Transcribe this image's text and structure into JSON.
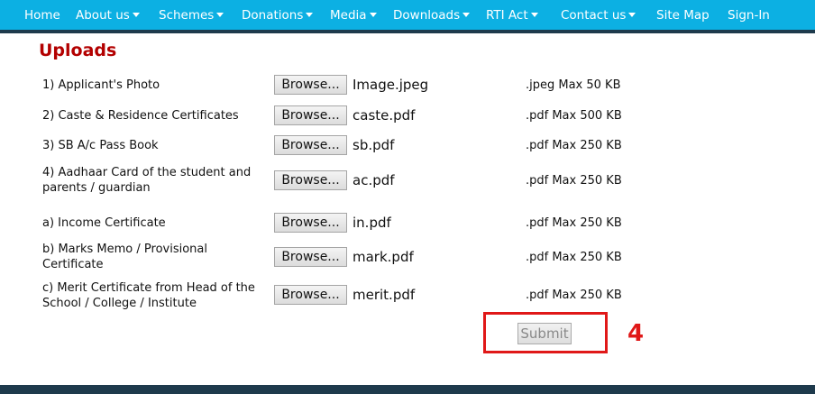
{
  "nav": {
    "items": [
      {
        "label": "Home",
        "dropdown": false
      },
      {
        "label": "About us",
        "dropdown": true
      },
      {
        "label": "Schemes",
        "dropdown": true
      },
      {
        "label": "Donations",
        "dropdown": true
      },
      {
        "label": "Media",
        "dropdown": true
      },
      {
        "label": "Downloads",
        "dropdown": true
      },
      {
        "label": "RTI Act",
        "dropdown": true
      },
      {
        "label": "Contact us",
        "dropdown": true
      },
      {
        "label": "Site Map",
        "dropdown": false
      },
      {
        "label": "Sign-In",
        "dropdown": false
      }
    ]
  },
  "page": {
    "title": "Uploads"
  },
  "uploads": {
    "browse_label": "Browse...",
    "rows": [
      {
        "label": "1) Applicant's Photo",
        "file": "Image.jpeg",
        "limit": ".jpeg Max 50 KB"
      },
      {
        "label": "2) Caste  & Residence Certificates",
        "file": "caste.pdf",
        "limit": ".pdf Max 500 KB"
      },
      {
        "label": "3) SB A/c Pass Book",
        "file": "sb.pdf",
        "limit": ".pdf Max 250 KB"
      },
      {
        "label": "4) Aadhaar Card of the student and parents / guardian",
        "file": "ac.pdf",
        "limit": ".pdf Max 250 KB"
      },
      {
        "label": "a) Income Certificate",
        "file": "in.pdf",
        "limit": ".pdf Max 250 KB"
      },
      {
        "label": "b) Marks Memo / Provisional Certificate",
        "file": "mark.pdf",
        "limit": ".pdf Max 250 KB"
      },
      {
        "label": "c) Merit Certificate from Head of the School / College / Institute",
        "file": "merit.pdf",
        "limit": ".pdf Max 250 KB"
      }
    ]
  },
  "form": {
    "submit_label": "Submit"
  },
  "annotation": {
    "step_number": "4"
  },
  "colors": {
    "nav_bg": "#0cb0e3",
    "nav_border": "#1e3a4c",
    "title": "#b30000",
    "annotation": "#e01818"
  }
}
